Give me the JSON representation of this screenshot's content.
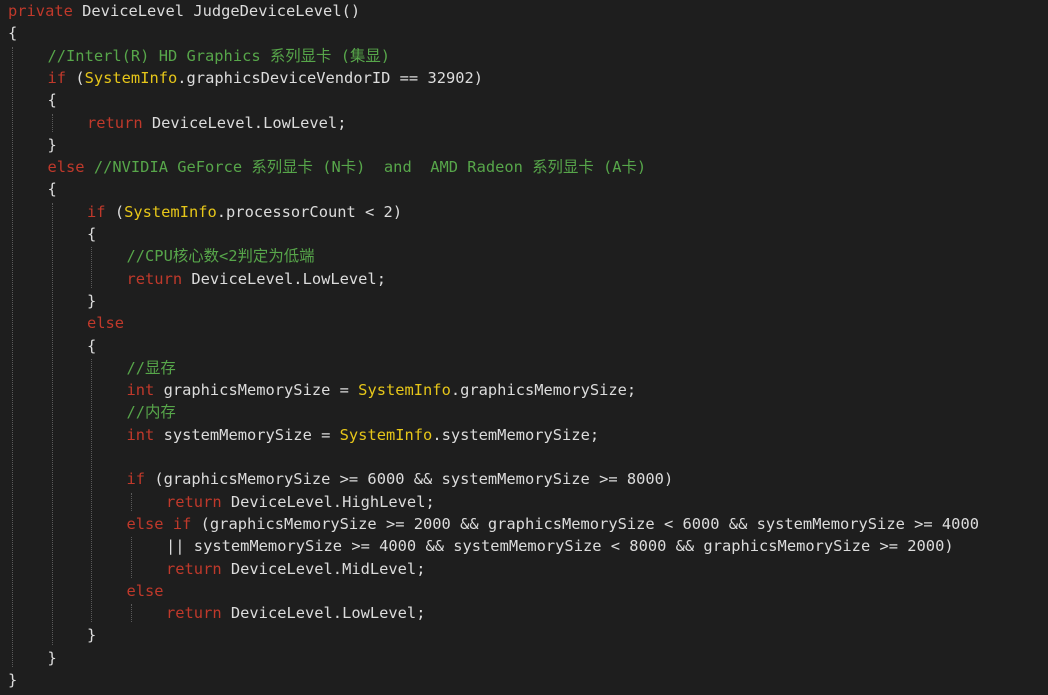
{
  "colors": {
    "background": "#1e1e1e",
    "keyword": "#c0392b",
    "type": "#e6c619",
    "comment": "#57a64a",
    "text": "#dcdcdc",
    "indent_guide": "#5a5a5a"
  },
  "code_lines": [
    {
      "indent": 0,
      "tokens": [
        {
          "t": "kw",
          "v": "private"
        },
        {
          "t": "tx",
          "v": " DeviceLevel JudgeDeviceLevel()"
        }
      ]
    },
    {
      "indent": 0,
      "tokens": [
        {
          "t": "tx",
          "v": "{"
        }
      ]
    },
    {
      "indent": 1,
      "tokens": [
        {
          "t": "cm",
          "v": "//Interl(R) HD Graphics 系列显卡 (集显)"
        }
      ]
    },
    {
      "indent": 1,
      "tokens": [
        {
          "t": "kw",
          "v": "if"
        },
        {
          "t": "tx",
          "v": " ("
        },
        {
          "t": "ty",
          "v": "SystemInfo"
        },
        {
          "t": "tx",
          "v": ".graphicsDeviceVendorID == 32902)"
        }
      ]
    },
    {
      "indent": 1,
      "tokens": [
        {
          "t": "tx",
          "v": "{"
        }
      ]
    },
    {
      "indent": 2,
      "tokens": [
        {
          "t": "kw",
          "v": "return"
        },
        {
          "t": "tx",
          "v": " DeviceLevel.LowLevel;"
        }
      ]
    },
    {
      "indent": 1,
      "tokens": [
        {
          "t": "tx",
          "v": "}"
        }
      ]
    },
    {
      "indent": 1,
      "tokens": [
        {
          "t": "kw",
          "v": "else"
        },
        {
          "t": "cm",
          "v": " //NVIDIA GeForce 系列显卡 (N卡)  and  AMD Radeon 系列显卡 (A卡)"
        }
      ]
    },
    {
      "indent": 1,
      "tokens": [
        {
          "t": "tx",
          "v": "{"
        }
      ]
    },
    {
      "indent": 2,
      "tokens": [
        {
          "t": "kw",
          "v": "if"
        },
        {
          "t": "tx",
          "v": " ("
        },
        {
          "t": "ty",
          "v": "SystemInfo"
        },
        {
          "t": "tx",
          "v": ".processorCount < 2)"
        }
      ]
    },
    {
      "indent": 2,
      "tokens": [
        {
          "t": "tx",
          "v": "{"
        }
      ]
    },
    {
      "indent": 3,
      "tokens": [
        {
          "t": "cm",
          "v": "//CPU核心数<2判定为低端"
        }
      ]
    },
    {
      "indent": 3,
      "tokens": [
        {
          "t": "kw",
          "v": "return"
        },
        {
          "t": "tx",
          "v": " DeviceLevel.LowLevel;"
        }
      ]
    },
    {
      "indent": 2,
      "tokens": [
        {
          "t": "tx",
          "v": "}"
        }
      ]
    },
    {
      "indent": 2,
      "tokens": [
        {
          "t": "kw",
          "v": "else"
        }
      ]
    },
    {
      "indent": 2,
      "tokens": [
        {
          "t": "tx",
          "v": "{"
        }
      ]
    },
    {
      "indent": 3,
      "tokens": [
        {
          "t": "cm",
          "v": "//显存"
        }
      ]
    },
    {
      "indent": 3,
      "tokens": [
        {
          "t": "kw",
          "v": "int"
        },
        {
          "t": "tx",
          "v": " graphicsMemorySize = "
        },
        {
          "t": "ty",
          "v": "SystemInfo"
        },
        {
          "t": "tx",
          "v": ".graphicsMemorySize;"
        }
      ]
    },
    {
      "indent": 3,
      "tokens": [
        {
          "t": "cm",
          "v": "//内存"
        }
      ]
    },
    {
      "indent": 3,
      "tokens": [
        {
          "t": "kw",
          "v": "int"
        },
        {
          "t": "tx",
          "v": " systemMemorySize = "
        },
        {
          "t": "ty",
          "v": "SystemInfo"
        },
        {
          "t": "tx",
          "v": ".systemMemorySize;"
        }
      ]
    },
    {
      "indent": 3,
      "tokens": []
    },
    {
      "indent": 3,
      "tokens": [
        {
          "t": "kw",
          "v": "if"
        },
        {
          "t": "tx",
          "v": " (graphicsMemorySize >= 6000 && systemMemorySize >= 8000)"
        }
      ]
    },
    {
      "indent": 4,
      "tokens": [
        {
          "t": "kw",
          "v": "return"
        },
        {
          "t": "tx",
          "v": " DeviceLevel.HighLevel;"
        }
      ]
    },
    {
      "indent": 3,
      "tokens": [
        {
          "t": "kw",
          "v": "else if"
        },
        {
          "t": "tx",
          "v": " (graphicsMemorySize >= 2000 && graphicsMemorySize < 6000 && systemMemorySize >= 4000"
        }
      ]
    },
    {
      "indent": 4,
      "tokens": [
        {
          "t": "tx",
          "v": "|| systemMemorySize >= 4000 && systemMemorySize < 8000 && graphicsMemorySize >= 2000)"
        }
      ]
    },
    {
      "indent": 4,
      "tokens": [
        {
          "t": "kw",
          "v": "return"
        },
        {
          "t": "tx",
          "v": " DeviceLevel.MidLevel;"
        }
      ]
    },
    {
      "indent": 3,
      "tokens": [
        {
          "t": "kw",
          "v": "else"
        }
      ]
    },
    {
      "indent": 4,
      "tokens": [
        {
          "t": "kw",
          "v": "return"
        },
        {
          "t": "tx",
          "v": " DeviceLevel.LowLevel;"
        }
      ]
    },
    {
      "indent": 2,
      "tokens": [
        {
          "t": "tx",
          "v": "}"
        }
      ]
    },
    {
      "indent": 1,
      "tokens": [
        {
          "t": "tx",
          "v": "}"
        }
      ]
    },
    {
      "indent": 0,
      "tokens": [
        {
          "t": "tx",
          "v": "}"
        }
      ]
    }
  ]
}
